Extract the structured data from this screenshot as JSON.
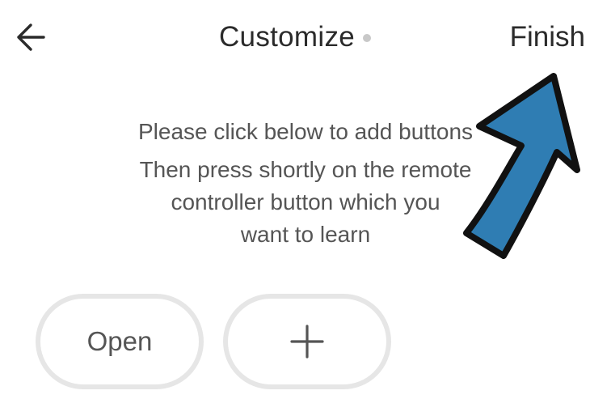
{
  "header": {
    "title": "Customize",
    "finish_label": "Finish"
  },
  "instructions": {
    "line1": "Please click below to add buttons",
    "line2": "Then press shortly on the remote",
    "line3": "controller button which you",
    "line4": "want to learn"
  },
  "buttons": {
    "open_label": "Open",
    "add_symbol": "+"
  },
  "icons": {
    "back": "arrow-left-icon",
    "status": "dot-indicator",
    "annotation": "blue-arrow-annotation"
  },
  "colors": {
    "annotation_fill": "#2f7db3",
    "pill_border": "#e6e6e6",
    "text_primary": "#2b2b2b",
    "text_secondary": "#555555"
  }
}
